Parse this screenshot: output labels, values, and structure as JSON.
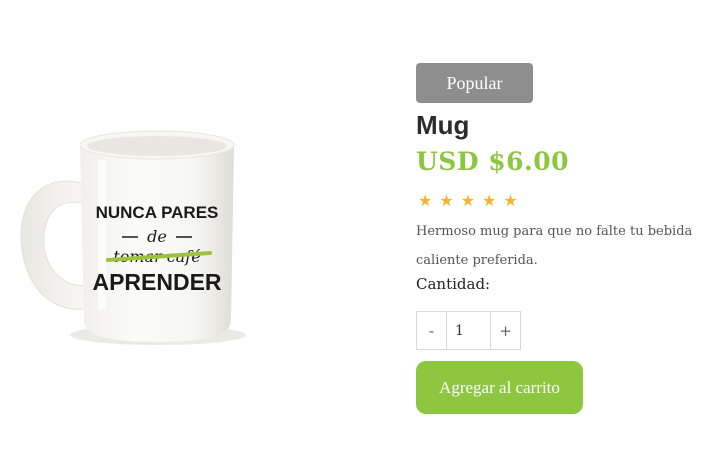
{
  "product": {
    "image": {
      "caption_lines": {
        "line1": "NUNCA PARES",
        "line2": "de",
        "line3": "tomar café",
        "line4": "APRENDER"
      },
      "accent_color": "#9cc33b"
    },
    "badge": "Popular",
    "title": "Mug",
    "price": "USD $6.00",
    "rating": 5,
    "rating_max": 5,
    "description": "Hermoso mug para que no falte tu bebida caliente preferida.",
    "quantity_label": "Cantidad:",
    "quantity": {
      "decrement": "-",
      "value": "1",
      "increment": "+"
    },
    "add_to_cart": "Agregar al carrito"
  },
  "colors": {
    "brand": "#8dc63f",
    "badge": "#8e8e8e",
    "star": "#f2b632"
  }
}
